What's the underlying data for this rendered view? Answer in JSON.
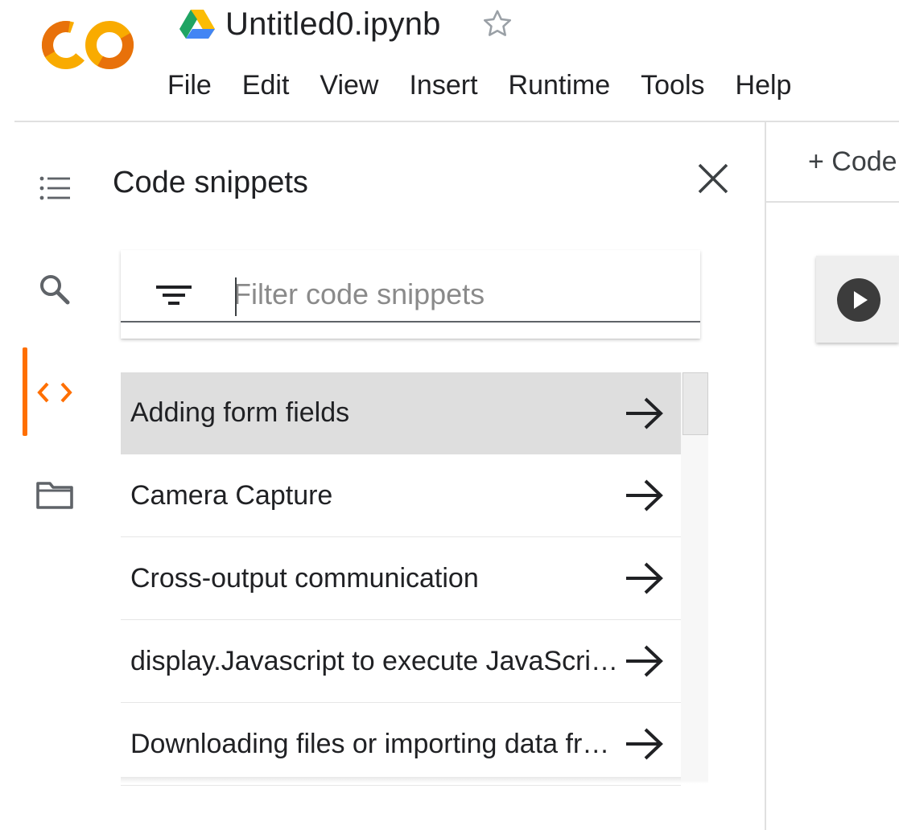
{
  "app": {
    "doc_title": "Untitled0.ipynb",
    "logo_icon": "colab-logo-icon",
    "drive_icon": "google-drive-icon",
    "star_icon": "star-outline-icon"
  },
  "menu": {
    "items": [
      {
        "label": "File"
      },
      {
        "label": "Edit"
      },
      {
        "label": "View"
      },
      {
        "label": "Insert"
      },
      {
        "label": "Runtime"
      },
      {
        "label": "Tools"
      },
      {
        "label": "Help"
      }
    ]
  },
  "rail": {
    "items": [
      {
        "icon": "table-of-contents-icon"
      },
      {
        "icon": "search-icon"
      },
      {
        "icon": "code-icon",
        "active": true
      },
      {
        "icon": "folder-icon"
      }
    ],
    "accent_color": "#ff6f00"
  },
  "panel": {
    "title": "Code snippets",
    "close_icon": "close-icon",
    "filter": {
      "icon": "filter-icon",
      "placeholder": "Filter code snippets",
      "value": ""
    },
    "snippets": [
      {
        "label": "Adding form fields",
        "selected": true
      },
      {
        "label": "Camera Capture",
        "selected": false
      },
      {
        "label": "Cross-output communication",
        "selected": false
      },
      {
        "label": "display.Javascript to execute JavaScript from Python",
        "selected": false
      },
      {
        "label": "Downloading files or importing data from Google Drive",
        "selected": false
      }
    ],
    "arrow_icon": "arrow-right-icon"
  },
  "main": {
    "add_code_label": "+ Code",
    "run_icon": "play-circle-icon"
  }
}
